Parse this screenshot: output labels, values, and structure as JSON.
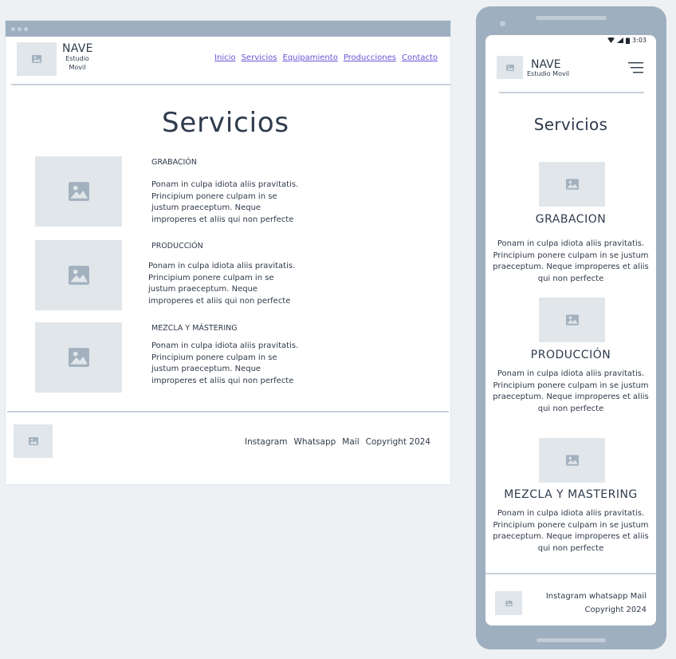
{
  "desktop": {
    "brand": {
      "title": "NAVE",
      "subtitle_line1": "Estudio",
      "subtitle_line2": "Movil"
    },
    "nav": [
      {
        "label": "Inicio"
      },
      {
        "label": "Servicios"
      },
      {
        "label": "Equipamiento"
      },
      {
        "label": "Producciones"
      },
      {
        "label": "Contacto"
      }
    ],
    "page_title": "Servicios",
    "services": [
      {
        "heading": "GRABACIÓN",
        "body": "Ponam in culpa idiota aliis pravitatis. Principium ponere culpam in se justum praeceptum. Neque improperes et aliis qui non perfecte"
      },
      {
        "heading": "PRODUCCIÓN",
        "body": "Ponam in culpa idiota aliis pravitatis. Principium ponere culpam in se justum praeceptum. Neque improperes et aliis qui non perfecte"
      },
      {
        "heading": "MEZCLA Y MÁSTERING",
        "body": "Ponam in culpa idiota aliis pravitatis. Principium ponere culpam in se justum praeceptum. Neque improperes et aliis qui non perfecte"
      }
    ],
    "footer": {
      "links": [
        "Instagram",
        "Whatsapp",
        "Mail"
      ],
      "copyright": "Copyright 2024"
    }
  },
  "mobile": {
    "status": {
      "time": "3:03"
    },
    "brand": {
      "title": "NAVE",
      "subtitle": "Estudio Movil"
    },
    "page_title": "Servicios",
    "services": [
      {
        "heading": "GRABACION",
        "body": "Ponam in culpa idiota aliis pravitatis. Principium ponere culpam in se justum praeceptum. Neque improperes et aliis qui non perfecte"
      },
      {
        "heading": "PRODUCCIÓN",
        "body": "Ponam in culpa idiota aliis pravitatis. Principium ponere culpam in se justum praeceptum. Neque improperes et aliis qui non perfecte"
      },
      {
        "heading": "MEZCLA Y MASTERING",
        "body": "Ponam in culpa idiota aliis pravitatis. Principium ponere culpam in se justum praeceptum. Neque improperes et aliis qui non perfecte"
      }
    ],
    "footer": {
      "links": "Instagram whatsapp  Mail",
      "copyright": "Copyright 2024"
    }
  },
  "colors": {
    "frame": "#9eafbf",
    "placeholder": "#e1e6eb",
    "placeholder_icon": "#a3b1bf",
    "link": "#6a54d8",
    "text": "#2f3a4a",
    "background": "#eef1f4"
  },
  "icons": {
    "image_placeholder": "image-icon",
    "menu": "hamburger-menu-icon",
    "wifi": "wifi-icon",
    "signal": "signal-icon",
    "battery": "battery-icon"
  }
}
